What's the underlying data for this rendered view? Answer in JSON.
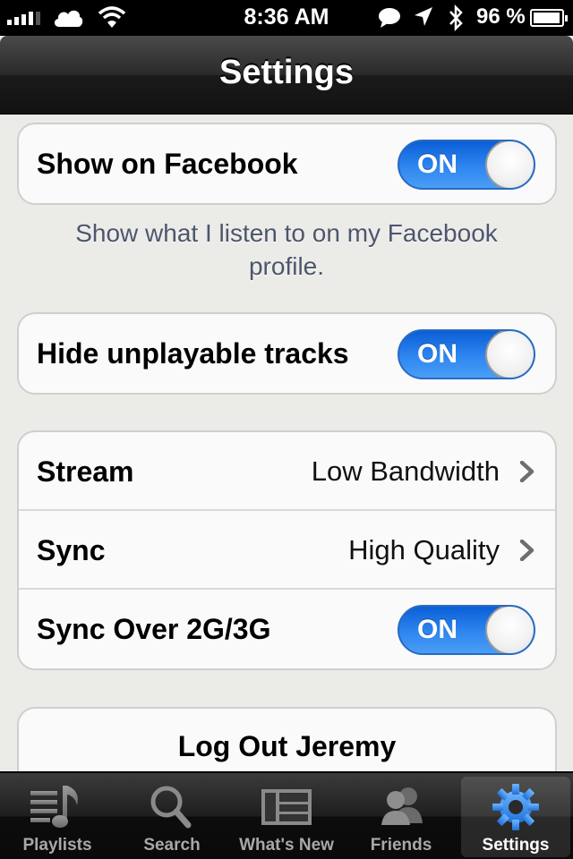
{
  "status_bar": {
    "time": "8:36 AM",
    "battery_percent": "96 %",
    "battery_level": 0.96,
    "icons": [
      "signal-icon",
      "cloud-icon",
      "wifi-icon",
      "message-icon",
      "location-icon",
      "bluetooth-icon",
      "battery-icon"
    ]
  },
  "nav": {
    "title": "Settings"
  },
  "facebook_group": {
    "label": "Show on Facebook",
    "toggle": "ON",
    "footer": "Show what I listen to on my Facebook profile."
  },
  "unplayable_group": {
    "label": "Hide unplayable tracks",
    "toggle": "ON"
  },
  "quality_group": {
    "stream": {
      "label": "Stream",
      "value": "Low Bandwidth"
    },
    "sync": {
      "label": "Sync",
      "value": "High Quality"
    },
    "sync_mobile": {
      "label": "Sync Over 2G/3G",
      "toggle": "ON"
    }
  },
  "logout": {
    "label": "Log Out Jeremy"
  },
  "tabs": [
    {
      "label": "Playlists",
      "icon": "playlists-icon"
    },
    {
      "label": "Search",
      "icon": "search-icon"
    },
    {
      "label": "What's New",
      "icon": "whats-new-icon"
    },
    {
      "label": "Friends",
      "icon": "friends-icon"
    },
    {
      "label": "Settings",
      "icon": "gear-icon",
      "active": true
    }
  ],
  "colors": {
    "toggle_blue": "#2e86f0",
    "active_tab_icon": "#3d95ef",
    "footer_text": "#4c566c"
  }
}
